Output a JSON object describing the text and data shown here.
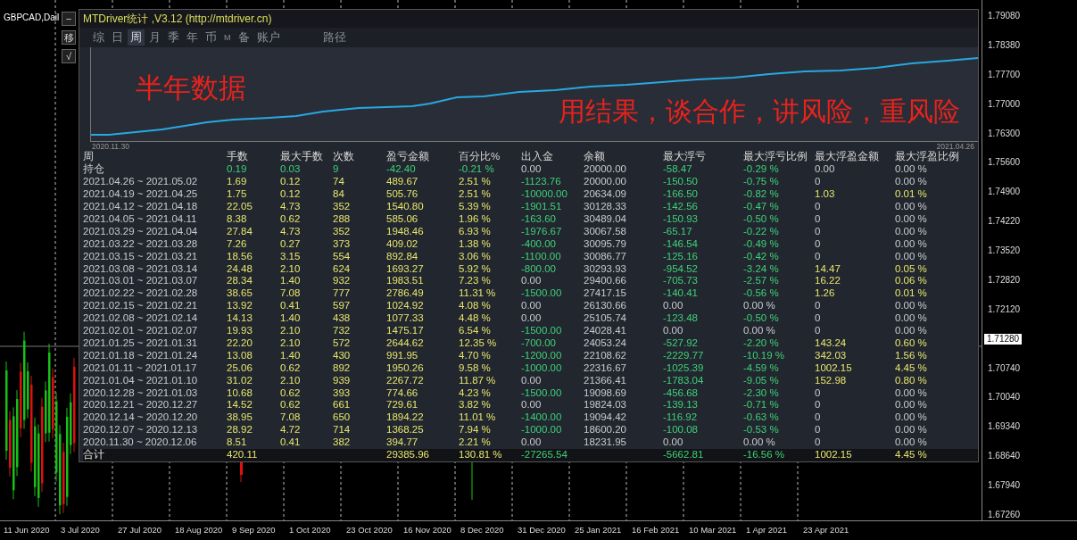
{
  "symbol_label": "GBPCAD,Dail",
  "side_buttons": [
    "−",
    "移",
    "√"
  ],
  "panel": {
    "title": "MTDriver统计 ,V3.12 (http://mtdriver.cn)",
    "tabs": [
      {
        "label": "综",
        "selected": false,
        "kind": "tab"
      },
      {
        "label": "日",
        "selected": false,
        "kind": "tab"
      },
      {
        "label": "周",
        "selected": true,
        "kind": "tab"
      },
      {
        "label": "月",
        "selected": false,
        "kind": "tab"
      },
      {
        "label": "季",
        "selected": false,
        "kind": "tab"
      },
      {
        "label": "年",
        "selected": false,
        "kind": "tab"
      },
      {
        "label": "币",
        "selected": false,
        "kind": "tab"
      },
      {
        "label": "M",
        "selected": false,
        "kind": "small"
      },
      {
        "label": "备",
        "selected": false,
        "kind": "tab"
      },
      {
        "label": "账户",
        "selected": false,
        "kind": "tab"
      },
      {
        "label": "路径",
        "selected": false,
        "kind": "path"
      }
    ],
    "equity_chart": {
      "captions": [
        "半年数据",
        "用结果，谈合作，讲风险，重风险"
      ],
      "start_label": "2020.11.30",
      "end_label": "2021.04.26"
    },
    "table": {
      "columns": [
        "周",
        "手数",
        "最大手数",
        "次数",
        "盈亏金额",
        "百分比%",
        "出入金",
        "余额",
        "最大浮亏",
        "最大浮亏比例",
        "最大浮盈金额",
        "最大浮盈比例"
      ],
      "rows": [
        {
          "kind": "holding",
          "cells": [
            {
              "text": "持仓",
              "kind": "plain"
            },
            {
              "text": "0.19",
              "kind": "loss"
            },
            {
              "text": "0.03",
              "kind": "loss"
            },
            {
              "text": "9",
              "kind": "loss"
            },
            {
              "text": "-42.40",
              "kind": "loss"
            },
            {
              "text": "-0.21 %",
              "kind": "loss"
            },
            {
              "text": "0.00",
              "kind": "plain"
            },
            {
              "text": "20000.00",
              "kind": "plain"
            },
            {
              "text": "-58.47",
              "kind": "loss"
            },
            {
              "text": "-0.29 %",
              "kind": "loss"
            },
            {
              "text": "0.00",
              "kind": "plain"
            },
            {
              "text": "0.00 %",
              "kind": "plain"
            }
          ]
        },
        {
          "kind": "week",
          "cells": [
            {
              "text": "2021.04.26 ~ 2021.05.02",
              "kind": "plain"
            },
            {
              "text": "1.69",
              "kind": "gain"
            },
            {
              "text": "0.12",
              "kind": "gain"
            },
            {
              "text": "74",
              "kind": "gain"
            },
            {
              "text": "489.67",
              "kind": "gain"
            },
            {
              "text": "2.51 %",
              "kind": "gain"
            },
            {
              "text": "-1123.76",
              "kind": "loss"
            },
            {
              "text": "20000.00",
              "kind": "plain"
            },
            {
              "text": "-150.50",
              "kind": "loss"
            },
            {
              "text": "-0.75 %",
              "kind": "loss"
            },
            {
              "text": "0",
              "kind": "plain"
            },
            {
              "text": "0.00 %",
              "kind": "plain"
            }
          ]
        },
        {
          "kind": "week",
          "cells": [
            {
              "text": "2021.04.19 ~ 2021.04.25",
              "kind": "plain"
            },
            {
              "text": "1.75",
              "kind": "gain"
            },
            {
              "text": "0.12",
              "kind": "gain"
            },
            {
              "text": "84",
              "kind": "gain"
            },
            {
              "text": "505.76",
              "kind": "gain"
            },
            {
              "text": "2.51 %",
              "kind": "gain"
            },
            {
              "text": "-10000.00",
              "kind": "loss"
            },
            {
              "text": "20634.09",
              "kind": "plain"
            },
            {
              "text": "-166.50",
              "kind": "loss"
            },
            {
              "text": "-0.82 %",
              "kind": "loss"
            },
            {
              "text": "1.03",
              "kind": "gain"
            },
            {
              "text": "0.01 %",
              "kind": "gain"
            }
          ]
        },
        {
          "kind": "week",
          "cells": [
            {
              "text": "2021.04.12 ~ 2021.04.18",
              "kind": "plain"
            },
            {
              "text": "22.05",
              "kind": "gain"
            },
            {
              "text": "4.73",
              "kind": "gain"
            },
            {
              "text": "352",
              "kind": "gain"
            },
            {
              "text": "1540.80",
              "kind": "gain"
            },
            {
              "text": "5.39 %",
              "kind": "gain"
            },
            {
              "text": "-1901.51",
              "kind": "loss"
            },
            {
              "text": "30128.33",
              "kind": "plain"
            },
            {
              "text": "-142.56",
              "kind": "loss"
            },
            {
              "text": "-0.47 %",
              "kind": "loss"
            },
            {
              "text": "0",
              "kind": "plain"
            },
            {
              "text": "0.00 %",
              "kind": "plain"
            }
          ]
        },
        {
          "kind": "week",
          "cells": [
            {
              "text": "2021.04.05 ~ 2021.04.11",
              "kind": "plain"
            },
            {
              "text": "8.38",
              "kind": "gain"
            },
            {
              "text": "0.62",
              "kind": "gain"
            },
            {
              "text": "288",
              "kind": "gain"
            },
            {
              "text": "585.06",
              "kind": "gain"
            },
            {
              "text": "1.96 %",
              "kind": "gain"
            },
            {
              "text": "-163.60",
              "kind": "loss"
            },
            {
              "text": "30489.04",
              "kind": "plain"
            },
            {
              "text": "-150.93",
              "kind": "loss"
            },
            {
              "text": "-0.50 %",
              "kind": "loss"
            },
            {
              "text": "0",
              "kind": "plain"
            },
            {
              "text": "0.00 %",
              "kind": "plain"
            }
          ]
        },
        {
          "kind": "week",
          "cells": [
            {
              "text": "2021.03.29 ~ 2021.04.04",
              "kind": "plain"
            },
            {
              "text": "27.84",
              "kind": "gain"
            },
            {
              "text": "4.73",
              "kind": "gain"
            },
            {
              "text": "352",
              "kind": "gain"
            },
            {
              "text": "1948.46",
              "kind": "gain"
            },
            {
              "text": "6.93 %",
              "kind": "gain"
            },
            {
              "text": "-1976.67",
              "kind": "loss"
            },
            {
              "text": "30067.58",
              "kind": "plain"
            },
            {
              "text": "-65.17",
              "kind": "loss"
            },
            {
              "text": "-0.22 %",
              "kind": "loss"
            },
            {
              "text": "0",
              "kind": "plain"
            },
            {
              "text": "0.00 %",
              "kind": "plain"
            }
          ]
        },
        {
          "kind": "week",
          "cells": [
            {
              "text": "2021.03.22 ~ 2021.03.28",
              "kind": "plain"
            },
            {
              "text": "7.26",
              "kind": "gain"
            },
            {
              "text": "0.27",
              "kind": "gain"
            },
            {
              "text": "373",
              "kind": "gain"
            },
            {
              "text": "409.02",
              "kind": "gain"
            },
            {
              "text": "1.38 %",
              "kind": "gain"
            },
            {
              "text": "-400.00",
              "kind": "loss"
            },
            {
              "text": "30095.79",
              "kind": "plain"
            },
            {
              "text": "-146.54",
              "kind": "loss"
            },
            {
              "text": "-0.49 %",
              "kind": "loss"
            },
            {
              "text": "0",
              "kind": "plain"
            },
            {
              "text": "0.00 %",
              "kind": "plain"
            }
          ]
        },
        {
          "kind": "week",
          "cells": [
            {
              "text": "2021.03.15 ~ 2021.03.21",
              "kind": "plain"
            },
            {
              "text": "18.56",
              "kind": "gain"
            },
            {
              "text": "3.15",
              "kind": "gain"
            },
            {
              "text": "554",
              "kind": "gain"
            },
            {
              "text": "892.84",
              "kind": "gain"
            },
            {
              "text": "3.06 %",
              "kind": "gain"
            },
            {
              "text": "-1100.00",
              "kind": "loss"
            },
            {
              "text": "30086.77",
              "kind": "plain"
            },
            {
              "text": "-125.16",
              "kind": "loss"
            },
            {
              "text": "-0.42 %",
              "kind": "loss"
            },
            {
              "text": "0",
              "kind": "plain"
            },
            {
              "text": "0.00 %",
              "kind": "plain"
            }
          ]
        },
        {
          "kind": "week",
          "cells": [
            {
              "text": "2021.03.08 ~ 2021.03.14",
              "kind": "plain"
            },
            {
              "text": "24.48",
              "kind": "gain"
            },
            {
              "text": "2.10",
              "kind": "gain"
            },
            {
              "text": "624",
              "kind": "gain"
            },
            {
              "text": "1693.27",
              "kind": "gain"
            },
            {
              "text": "5.92 %",
              "kind": "gain"
            },
            {
              "text": "-800.00",
              "kind": "loss"
            },
            {
              "text": "30293.93",
              "kind": "plain"
            },
            {
              "text": "-954.52",
              "kind": "loss"
            },
            {
              "text": "-3.24 %",
              "kind": "loss"
            },
            {
              "text": "14.47",
              "kind": "gain"
            },
            {
              "text": "0.05 %",
              "kind": "gain"
            }
          ]
        },
        {
          "kind": "week",
          "cells": [
            {
              "text": "2021.03.01 ~ 2021.03.07",
              "kind": "plain"
            },
            {
              "text": "28.34",
              "kind": "gain"
            },
            {
              "text": "1.40",
              "kind": "gain"
            },
            {
              "text": "932",
              "kind": "gain"
            },
            {
              "text": "1983.51",
              "kind": "gain"
            },
            {
              "text": "7.23 %",
              "kind": "gain"
            },
            {
              "text": "0.00",
              "kind": "plain"
            },
            {
              "text": "29400.66",
              "kind": "plain"
            },
            {
              "text": "-705.73",
              "kind": "loss"
            },
            {
              "text": "-2.57 %",
              "kind": "loss"
            },
            {
              "text": "16.22",
              "kind": "gain"
            },
            {
              "text": "0.06 %",
              "kind": "gain"
            }
          ]
        },
        {
          "kind": "week",
          "cells": [
            {
              "text": "2021.02.22 ~ 2021.02.28",
              "kind": "plain"
            },
            {
              "text": "38.65",
              "kind": "gain"
            },
            {
              "text": "7.08",
              "kind": "gain"
            },
            {
              "text": "777",
              "kind": "gain"
            },
            {
              "text": "2786.49",
              "kind": "gain"
            },
            {
              "text": "11.31 %",
              "kind": "gain"
            },
            {
              "text": "-1500.00",
              "kind": "loss"
            },
            {
              "text": "27417.15",
              "kind": "plain"
            },
            {
              "text": "-140.41",
              "kind": "loss"
            },
            {
              "text": "-0.56 %",
              "kind": "loss"
            },
            {
              "text": "1.26",
              "kind": "gain"
            },
            {
              "text": "0.01 %",
              "kind": "gain"
            }
          ]
        },
        {
          "kind": "week",
          "cells": [
            {
              "text": "2021.02.15 ~ 2021.02.21",
              "kind": "plain"
            },
            {
              "text": "13.92",
              "kind": "gain"
            },
            {
              "text": "0.41",
              "kind": "gain"
            },
            {
              "text": "597",
              "kind": "gain"
            },
            {
              "text": "1024.92",
              "kind": "gain"
            },
            {
              "text": "4.08 %",
              "kind": "gain"
            },
            {
              "text": "0.00",
              "kind": "plain"
            },
            {
              "text": "26130.66",
              "kind": "plain"
            },
            {
              "text": "0.00",
              "kind": "plain"
            },
            {
              "text": "0.00 %",
              "kind": "plain"
            },
            {
              "text": "0",
              "kind": "plain"
            },
            {
              "text": "0.00 %",
              "kind": "plain"
            }
          ]
        },
        {
          "kind": "week",
          "cells": [
            {
              "text": "2021.02.08 ~ 2021.02.14",
              "kind": "plain"
            },
            {
              "text": "14.13",
              "kind": "gain"
            },
            {
              "text": "1.40",
              "kind": "gain"
            },
            {
              "text": "438",
              "kind": "gain"
            },
            {
              "text": "1077.33",
              "kind": "gain"
            },
            {
              "text": "4.48 %",
              "kind": "gain"
            },
            {
              "text": "0.00",
              "kind": "plain"
            },
            {
              "text": "25105.74",
              "kind": "plain"
            },
            {
              "text": "-123.48",
              "kind": "loss"
            },
            {
              "text": "-0.50 %",
              "kind": "loss"
            },
            {
              "text": "0",
              "kind": "plain"
            },
            {
              "text": "0.00 %",
              "kind": "plain"
            }
          ]
        },
        {
          "kind": "week",
          "cells": [
            {
              "text": "2021.02.01 ~ 2021.02.07",
              "kind": "plain"
            },
            {
              "text": "19.93",
              "kind": "gain"
            },
            {
              "text": "2.10",
              "kind": "gain"
            },
            {
              "text": "732",
              "kind": "gain"
            },
            {
              "text": "1475.17",
              "kind": "gain"
            },
            {
              "text": "6.54 %",
              "kind": "gain"
            },
            {
              "text": "-1500.00",
              "kind": "loss"
            },
            {
              "text": "24028.41",
              "kind": "plain"
            },
            {
              "text": "0.00",
              "kind": "plain"
            },
            {
              "text": "0.00 %",
              "kind": "plain"
            },
            {
              "text": "0",
              "kind": "plain"
            },
            {
              "text": "0.00 %",
              "kind": "plain"
            }
          ]
        },
        {
          "kind": "week",
          "cells": [
            {
              "text": "2021.01.25 ~ 2021.01.31",
              "kind": "plain"
            },
            {
              "text": "22.20",
              "kind": "gain"
            },
            {
              "text": "2.10",
              "kind": "gain"
            },
            {
              "text": "572",
              "kind": "gain"
            },
            {
              "text": "2644.62",
              "kind": "gain"
            },
            {
              "text": "12.35 %",
              "kind": "gain"
            },
            {
              "text": "-700.00",
              "kind": "loss"
            },
            {
              "text": "24053.24",
              "kind": "plain"
            },
            {
              "text": "-527.92",
              "kind": "loss"
            },
            {
              "text": "-2.20 %",
              "kind": "loss"
            },
            {
              "text": "143.24",
              "kind": "gain"
            },
            {
              "text": "0.60 %",
              "kind": "gain"
            }
          ]
        },
        {
          "kind": "week",
          "cells": [
            {
              "text": "2021.01.18 ~ 2021.01.24",
              "kind": "plain"
            },
            {
              "text": "13.08",
              "kind": "gain"
            },
            {
              "text": "1.40",
              "kind": "gain"
            },
            {
              "text": "430",
              "kind": "gain"
            },
            {
              "text": "991.95",
              "kind": "gain"
            },
            {
              "text": "4.70 %",
              "kind": "gain"
            },
            {
              "text": "-1200.00",
              "kind": "loss"
            },
            {
              "text": "22108.62",
              "kind": "plain"
            },
            {
              "text": "-2229.77",
              "kind": "loss"
            },
            {
              "text": "-10.19 %",
              "kind": "loss"
            },
            {
              "text": "342.03",
              "kind": "gain"
            },
            {
              "text": "1.56 %",
              "kind": "gain"
            }
          ]
        },
        {
          "kind": "week",
          "cells": [
            {
              "text": "2021.01.11 ~ 2021.01.17",
              "kind": "plain"
            },
            {
              "text": "25.06",
              "kind": "gain"
            },
            {
              "text": "0.62",
              "kind": "gain"
            },
            {
              "text": "892",
              "kind": "gain"
            },
            {
              "text": "1950.26",
              "kind": "gain"
            },
            {
              "text": "9.58 %",
              "kind": "gain"
            },
            {
              "text": "-1000.00",
              "kind": "loss"
            },
            {
              "text": "22316.67",
              "kind": "plain"
            },
            {
              "text": "-1025.39",
              "kind": "loss"
            },
            {
              "text": "-4.59 %",
              "kind": "loss"
            },
            {
              "text": "1002.15",
              "kind": "gain"
            },
            {
              "text": "4.45 %",
              "kind": "gain"
            }
          ]
        },
        {
          "kind": "week",
          "cells": [
            {
              "text": "2021.01.04 ~ 2021.01.10",
              "kind": "plain"
            },
            {
              "text": "31.02",
              "kind": "gain"
            },
            {
              "text": "2.10",
              "kind": "gain"
            },
            {
              "text": "939",
              "kind": "gain"
            },
            {
              "text": "2267.72",
              "kind": "gain"
            },
            {
              "text": "11.87 %",
              "kind": "gain"
            },
            {
              "text": "0.00",
              "kind": "plain"
            },
            {
              "text": "21366.41",
              "kind": "plain"
            },
            {
              "text": "-1783.04",
              "kind": "loss"
            },
            {
              "text": "-9.05 %",
              "kind": "loss"
            },
            {
              "text": "152.98",
              "kind": "gain"
            },
            {
              "text": "0.80 %",
              "kind": "gain"
            }
          ]
        },
        {
          "kind": "week",
          "cells": [
            {
              "text": "2020.12.28 ~ 2021.01.03",
              "kind": "plain"
            },
            {
              "text": "10.68",
              "kind": "gain"
            },
            {
              "text": "0.62",
              "kind": "gain"
            },
            {
              "text": "393",
              "kind": "gain"
            },
            {
              "text": "774.66",
              "kind": "gain"
            },
            {
              "text": "4.23 %",
              "kind": "gain"
            },
            {
              "text": "-1500.00",
              "kind": "loss"
            },
            {
              "text": "19098.69",
              "kind": "plain"
            },
            {
              "text": "-456.68",
              "kind": "loss"
            },
            {
              "text": "-2.30 %",
              "kind": "loss"
            },
            {
              "text": "0",
              "kind": "plain"
            },
            {
              "text": "0.00 %",
              "kind": "plain"
            }
          ]
        },
        {
          "kind": "week",
          "cells": [
            {
              "text": "2020.12.21 ~ 2020.12.27",
              "kind": "plain"
            },
            {
              "text": "14.52",
              "kind": "gain"
            },
            {
              "text": "0.62",
              "kind": "gain"
            },
            {
              "text": "661",
              "kind": "gain"
            },
            {
              "text": "729.61",
              "kind": "gain"
            },
            {
              "text": "3.82 %",
              "kind": "gain"
            },
            {
              "text": "0.00",
              "kind": "plain"
            },
            {
              "text": "19824.03",
              "kind": "plain"
            },
            {
              "text": "-139.13",
              "kind": "loss"
            },
            {
              "text": "-0.71 %",
              "kind": "loss"
            },
            {
              "text": "0",
              "kind": "plain"
            },
            {
              "text": "0.00 %",
              "kind": "plain"
            }
          ]
        },
        {
          "kind": "week",
          "cells": [
            {
              "text": "2020.12.14 ~ 2020.12.20",
              "kind": "plain"
            },
            {
              "text": "38.95",
              "kind": "gain"
            },
            {
              "text": "7.08",
              "kind": "gain"
            },
            {
              "text": "650",
              "kind": "gain"
            },
            {
              "text": "1894.22",
              "kind": "gain"
            },
            {
              "text": "11.01 %",
              "kind": "gain"
            },
            {
              "text": "-1400.00",
              "kind": "loss"
            },
            {
              "text": "19094.42",
              "kind": "plain"
            },
            {
              "text": "-116.92",
              "kind": "loss"
            },
            {
              "text": "-0.63 %",
              "kind": "loss"
            },
            {
              "text": "0",
              "kind": "plain"
            },
            {
              "text": "0.00 %",
              "kind": "plain"
            }
          ]
        },
        {
          "kind": "week",
          "cells": [
            {
              "text": "2020.12.07 ~ 2020.12.13",
              "kind": "plain"
            },
            {
              "text": "28.92",
              "kind": "gain"
            },
            {
              "text": "4.72",
              "kind": "gain"
            },
            {
              "text": "714",
              "kind": "gain"
            },
            {
              "text": "1368.25",
              "kind": "gain"
            },
            {
              "text": "7.94 %",
              "kind": "gain"
            },
            {
              "text": "-1000.00",
              "kind": "loss"
            },
            {
              "text": "18600.20",
              "kind": "plain"
            },
            {
              "text": "-100.08",
              "kind": "loss"
            },
            {
              "text": "-0.53 %",
              "kind": "loss"
            },
            {
              "text": "0",
              "kind": "plain"
            },
            {
              "text": "0.00 %",
              "kind": "plain"
            }
          ]
        },
        {
          "kind": "week",
          "cells": [
            {
              "text": "2020.11.30 ~ 2020.12.06",
              "kind": "plain"
            },
            {
              "text": "8.51",
              "kind": "gain"
            },
            {
              "text": "0.41",
              "kind": "gain"
            },
            {
              "text": "382",
              "kind": "gain"
            },
            {
              "text": "394.77",
              "kind": "gain"
            },
            {
              "text": "2.21 %",
              "kind": "gain"
            },
            {
              "text": "0.00",
              "kind": "plain"
            },
            {
              "text": "18231.95",
              "kind": "plain"
            },
            {
              "text": "0.00",
              "kind": "plain"
            },
            {
              "text": "0.00 %",
              "kind": "plain"
            },
            {
              "text": "0",
              "kind": "plain"
            },
            {
              "text": "0.00 %",
              "kind": "plain"
            }
          ]
        },
        {
          "kind": "total",
          "cells": [
            {
              "text": "合计",
              "kind": "head"
            },
            {
              "text": "420.11",
              "kind": "gain"
            },
            null,
            null,
            {
              "text": "29385.96",
              "kind": "gain"
            },
            {
              "text": "130.81 %",
              "kind": "gain"
            },
            {
              "text": "-27265.54",
              "kind": "loss"
            },
            null,
            {
              "text": "-5662.81",
              "kind": "loss"
            },
            {
              "text": "-16.56 %",
              "kind": "loss"
            },
            {
              "text": "1002.15",
              "kind": "gain"
            },
            {
              "text": "4.45 %",
              "kind": "gain"
            }
          ]
        }
      ]
    }
  },
  "price_axis": [
    {
      "text": "1.79080",
      "kind": "tick"
    },
    {
      "text": "1.78380",
      "kind": "tick"
    },
    {
      "text": "1.77700",
      "kind": "tick"
    },
    {
      "text": "1.77000",
      "kind": "tick"
    },
    {
      "text": "1.76300",
      "kind": "tick"
    },
    {
      "text": "1.75600",
      "kind": "tick"
    },
    {
      "text": "1.74900",
      "kind": "tick"
    },
    {
      "text": "1.74220",
      "kind": "tick"
    },
    {
      "text": "1.73520",
      "kind": "tick"
    },
    {
      "text": "1.72820",
      "kind": "tick"
    },
    {
      "text": "1.72120",
      "kind": "tick"
    },
    {
      "text": "1.71280",
      "kind": "current"
    },
    {
      "text": "1.70740",
      "kind": "tick"
    },
    {
      "text": "1.70040",
      "kind": "tick"
    },
    {
      "text": "1.69340",
      "kind": "tick"
    },
    {
      "text": "1.68640",
      "kind": "tick"
    },
    {
      "text": "1.67940",
      "kind": "tick"
    },
    {
      "text": "1.67260",
      "kind": "tick"
    }
  ],
  "time_axis": [
    "11 Jun 2020",
    "3 Jul 2020",
    "27 Jul 2020",
    "18 Aug 2020",
    "9 Sep 2020",
    "1 Oct 2020",
    "23 Oct 2020",
    "16 Nov 2020",
    "8 Dec 2020",
    "31 Dec 2020",
    "25 Jan 2021",
    "16 Feb 2021",
    "10 Mar 2021",
    "1 Apr 2021",
    "23 Apr 2021"
  ]
}
